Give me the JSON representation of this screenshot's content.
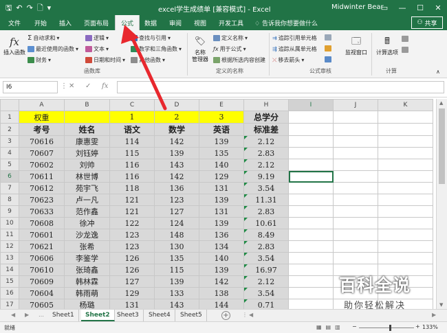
{
  "titlebar": {
    "title": "excel学生成绩单  [兼容模式]  -  Excel",
    "user": "Midwinter Bear"
  },
  "tabs": [
    "文件",
    "开始",
    "插入",
    "页面布局",
    "公式",
    "数据",
    "审阅",
    "视图",
    "开发工具"
  ],
  "active_tab": "公式",
  "tellme": "告诉我你想要做什么",
  "share": "共享",
  "ribbon": {
    "insert_function": "插入函数",
    "autosum": "自动求和",
    "recent": "最近使用的函数",
    "financial": "财务",
    "logical": "逻辑",
    "text": "文本",
    "datetime": "日期和时间",
    "lookup": "查找与引用",
    "math": "数学和三角函数",
    "other": "其他函数",
    "group_library": "函数库",
    "name_manager": "名称\n管理器",
    "define_name": "定义名称",
    "use_in_formula": "用于公式",
    "create_from_sel": "根据所选内容创建",
    "group_names": "定义的名称",
    "trace_precedents": "追踪引用单元格",
    "trace_dependents": "追踪从属单元格",
    "remove_arrows": "移去箭头",
    "group_audit": "公式审核",
    "watch_window": "监视窗口",
    "calc_options": "计算选项",
    "group_calc": "计算"
  },
  "namebox": "I6",
  "columns": [
    "A",
    "B",
    "C",
    "D",
    "E",
    "H",
    "I",
    "J",
    "K"
  ],
  "selected_column": "I",
  "selected_row": 6,
  "row1": {
    "label": "权重",
    "c": "1",
    "d": "2",
    "e": "3",
    "h": "总学分"
  },
  "row2": {
    "a": "考号",
    "b": "姓名",
    "c": "语文",
    "d": "数学",
    "e": "英语",
    "h": "标准差"
  },
  "rows": [
    {
      "n": 3,
      "a": "70616",
      "b": "康惠雯",
      "c": "114",
      "d": "142",
      "e": "139",
      "h": "2.12"
    },
    {
      "n": 4,
      "a": "70607",
      "b": "刘钰婷",
      "c": "115",
      "d": "139",
      "e": "135",
      "h": "2.83"
    },
    {
      "n": 5,
      "a": "70602",
      "b": "刘帅",
      "c": "116",
      "d": "143",
      "e": "140",
      "h": "2.12"
    },
    {
      "n": 6,
      "a": "70611",
      "b": "林世博",
      "c": "116",
      "d": "142",
      "e": "129",
      "h": "9.19"
    },
    {
      "n": 7,
      "a": "70612",
      "b": "苑宇飞",
      "c": "118",
      "d": "136",
      "e": "131",
      "h": "3.54"
    },
    {
      "n": 8,
      "a": "70623",
      "b": "卢一凡",
      "c": "121",
      "d": "123",
      "e": "139",
      "h": "11.31"
    },
    {
      "n": 9,
      "a": "70633",
      "b": "范作鑫",
      "c": "121",
      "d": "127",
      "e": "131",
      "h": "2.83"
    },
    {
      "n": 10,
      "a": "70608",
      "b": "徐冲",
      "c": "122",
      "d": "124",
      "e": "139",
      "h": "10.61"
    },
    {
      "n": 11,
      "a": "70601",
      "b": "沙龙逸",
      "c": "123",
      "d": "148",
      "e": "136",
      "h": "8.49"
    },
    {
      "n": 12,
      "a": "70621",
      "b": "张希",
      "c": "123",
      "d": "130",
      "e": "134",
      "h": "2.83"
    },
    {
      "n": 13,
      "a": "70606",
      "b": "李鉴学",
      "c": "126",
      "d": "135",
      "e": "140",
      "h": "3.54"
    },
    {
      "n": 14,
      "a": "70610",
      "b": "张琦鑫",
      "c": "126",
      "d": "115",
      "e": "139",
      "h": "16.97"
    },
    {
      "n": 15,
      "a": "70609",
      "b": "韩林霖",
      "c": "127",
      "d": "139",
      "e": "142",
      "h": "2.12"
    },
    {
      "n": 16,
      "a": "70604",
      "b": "韩雨萌",
      "c": "129",
      "d": "133",
      "e": "138",
      "h": "3.54"
    },
    {
      "n": 17,
      "a": "70605",
      "b": "杨璐",
      "c": "131",
      "d": "143",
      "e": "144",
      "h": "0.71"
    }
  ],
  "sheets": [
    "Sheet1",
    "Sheet2",
    "Sheet3",
    "Sheet4",
    "Sheet5"
  ],
  "active_sheet": "Sheet2",
  "status": {
    "ready": "就绪",
    "zoom": "133%"
  },
  "watermark": {
    "line1": "百科全说",
    "line2": "助你轻松解决"
  },
  "colors": {
    "excel_green": "#217346",
    "highlight_yellow": "#ffff00",
    "cell_gray": "#d9d9d9",
    "arrow_red": "#e8282e"
  }
}
